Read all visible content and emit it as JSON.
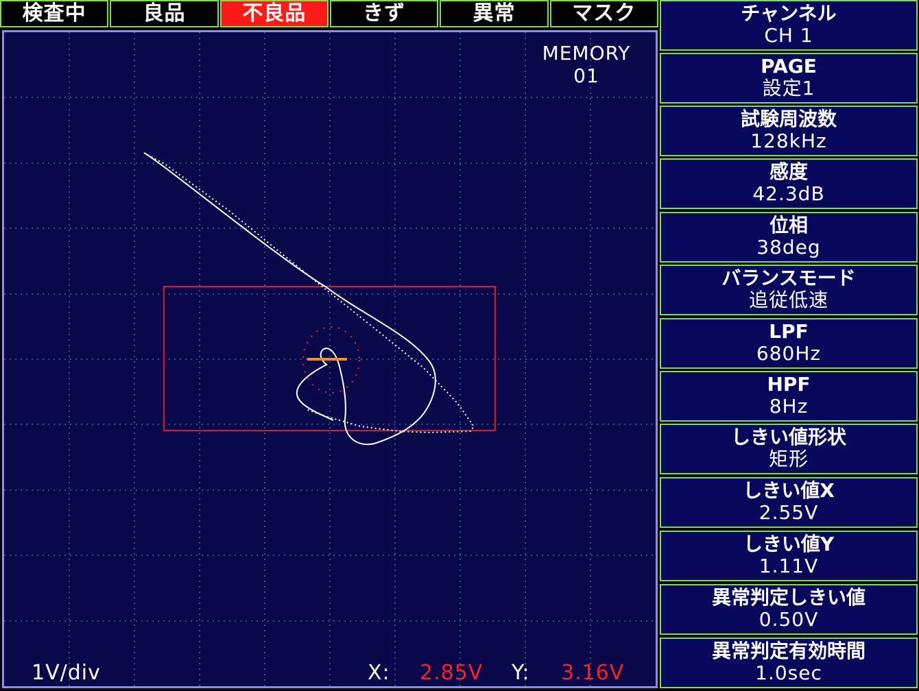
{
  "status_tabs": [
    {
      "label": "検査中",
      "active": false
    },
    {
      "label": "良品",
      "active": false
    },
    {
      "label": "不良品",
      "active": true
    },
    {
      "label": "きず",
      "active": false
    },
    {
      "label": "異常",
      "active": false
    },
    {
      "label": "マスク",
      "active": false
    }
  ],
  "scope": {
    "memory_title": "MEMORY",
    "memory_number": "01",
    "scale": "1V/div",
    "x_label": "X:",
    "x_value": "2.85V",
    "y_label": "Y:",
    "y_value": "3.16V"
  },
  "params": [
    {
      "name": "チャンネル",
      "value": "CH 1"
    },
    {
      "name": "PAGE",
      "value": "設定1"
    },
    {
      "name": "試験周波数",
      "value": "128kHz"
    },
    {
      "name": "感度",
      "value": "42.3dB"
    },
    {
      "name": "位相",
      "value": "38deg"
    },
    {
      "name": "バランスモード",
      "value": "追従低速"
    },
    {
      "name": "LPF",
      "value": "680Hz"
    },
    {
      "name": "HPF",
      "value": "8Hz"
    },
    {
      "name": "しきい値形状",
      "value": "矩形"
    },
    {
      "name": "しきい値X",
      "value": "2.55V"
    },
    {
      "name": "しきい値Y",
      "value": "1.11V"
    },
    {
      "name": "異常判定しきい値",
      "value": "0.50V"
    },
    {
      "name": "異常判定有効時間",
      "value": "1.0sec"
    }
  ],
  "colors": {
    "scope_background": "#08084a",
    "grid": "#4fa3c8",
    "threshold_box": "#e01818",
    "trace": "#ffffff",
    "marker": "#ff8c1a",
    "active_tab": "#ff1a1a",
    "tab_border": "#7be04a",
    "panel_background": "#07075c"
  }
}
